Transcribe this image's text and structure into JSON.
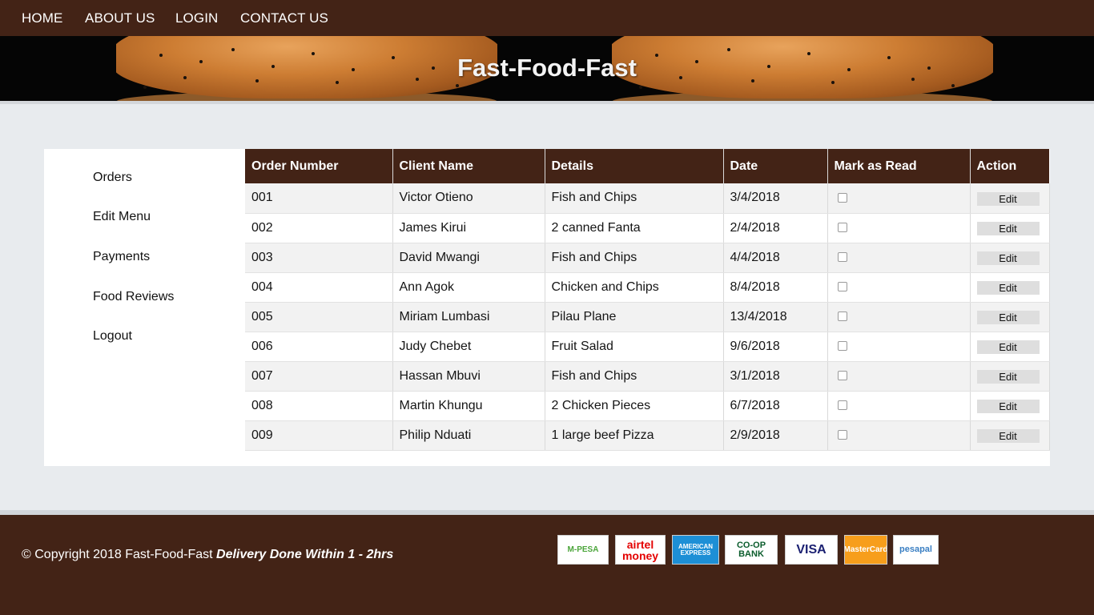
{
  "nav": {
    "items": [
      "HOME",
      "ABOUT US",
      "LOGIN",
      "CONTACT US"
    ]
  },
  "banner": {
    "title": "Fast-Food-Fast"
  },
  "sidebar": {
    "items": [
      "Orders",
      "Edit Menu",
      "Payments",
      "Food Reviews",
      "Logout"
    ]
  },
  "orders": {
    "headers": [
      "Order Number",
      "Client Name",
      "Details",
      "Date",
      "Mark as Read",
      "Action"
    ],
    "edit_label": "Edit",
    "rows": [
      [
        "001",
        "Victor Otieno",
        "Fish and Chips",
        "3/4/2018"
      ],
      [
        "002",
        "James Kirui",
        "2 canned Fanta",
        "2/4/2018"
      ],
      [
        "003",
        "David Mwangi",
        "Fish and Chips",
        "4/4/2018"
      ],
      [
        "004",
        "Ann Agok",
        "Chicken and Chips",
        "8/4/2018"
      ],
      [
        "005",
        "Miriam Lumbasi",
        "Pilau Plane",
        "13/4/2018"
      ],
      [
        "006",
        "Judy Chebet",
        "Fruit Salad",
        "9/6/2018"
      ],
      [
        "007",
        "Hassan Mbuvi",
        "Fish and Chips",
        "3/1/2018"
      ],
      [
        "008",
        "Martin Khungu",
        "2 Chicken Pieces",
        "6/7/2018"
      ],
      [
        "009",
        "Philip Nduati",
        "1 large beef Pizza",
        "2/9/2018"
      ]
    ]
  },
  "footer": {
    "copyright": "© Copyright 2018 Fast-Food-Fast",
    "tagline": "Delivery Done Within 1 - 2hrs",
    "payments": [
      {
        "label": "M-PESA",
        "color": "#4ba53a",
        "bg": "#ffffff"
      },
      {
        "label": "airtel money",
        "color": "#e40000",
        "bg": "#ffffff"
      },
      {
        "label": "AMERICAN EXPRESS",
        "color": "#ffffff",
        "bg": "#1d8fd6"
      },
      {
        "label": "CO-OP BANK",
        "color": "#0a5c2c",
        "bg": "#ffffff"
      },
      {
        "label": "VISA",
        "color": "#1a1f71",
        "bg": "#ffffff"
      },
      {
        "label": "MasterCard",
        "color": "#ffffff",
        "bg": "#f79e1b"
      },
      {
        "label": "pesapal",
        "color": "#3a7fc3",
        "bg": "#ffffff"
      }
    ]
  }
}
